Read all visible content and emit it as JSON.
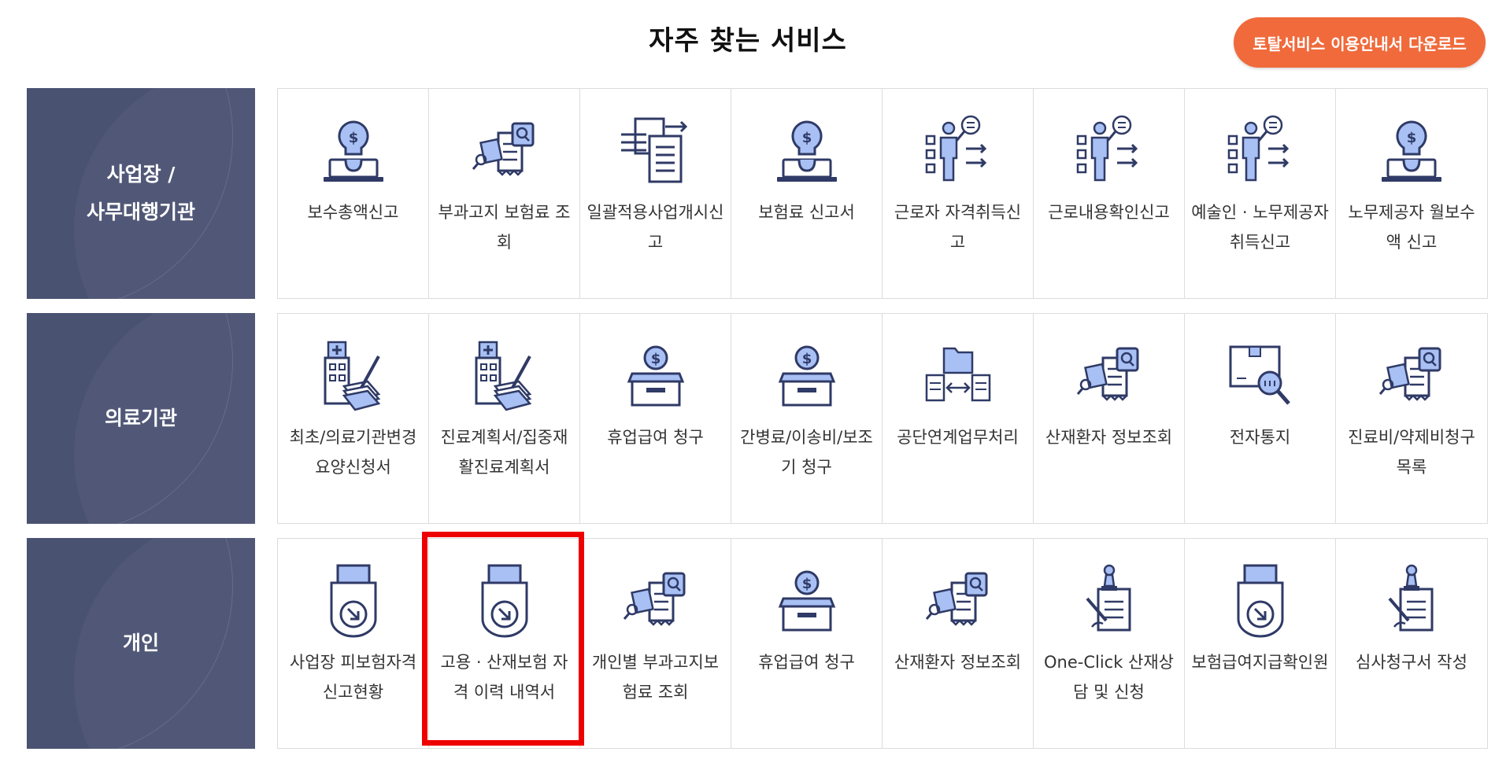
{
  "header": {
    "title": "자주 찾는 서비스",
    "download_button": "토탈서비스 이용안내서 다운로드"
  },
  "colors": {
    "accent": "#f06a3b",
    "sidebar": "#4a5272",
    "icon_stroke": "#2f3a66",
    "icon_fill": "#a8c0f4",
    "highlight": "#ee0000"
  },
  "rows": [
    {
      "category": "사업장 /\n사무대행기관",
      "items": [
        {
          "label": "보수총액신고",
          "icon": "money-bulb-laptop-icon"
        },
        {
          "label": "부과고지 보험료 조회",
          "icon": "document-search-icon"
        },
        {
          "label": "일괄적용사업개시신고",
          "icon": "document-transfer-icon"
        },
        {
          "label": "보험료 신고서",
          "icon": "money-bulb-laptop-icon"
        },
        {
          "label": "근로자 자격취득신고",
          "icon": "presenter-checklist-icon"
        },
        {
          "label": "근로내용확인신고",
          "icon": "presenter-checklist-icon"
        },
        {
          "label": "예술인 · 노무제공자 취득신고",
          "icon": "presenter-checklist-icon"
        },
        {
          "label": "노무제공자 월보수액 신고",
          "icon": "money-bulb-laptop-icon"
        }
      ]
    },
    {
      "category": "의료기관",
      "items": [
        {
          "label": "최초/의료기관변경 요양신청서",
          "icon": "hospital-write-icon"
        },
        {
          "label": "진료계획서/집중재활진료계획서",
          "icon": "hospital-write-icon"
        },
        {
          "label": "휴업급여 청구",
          "icon": "coin-box-icon"
        },
        {
          "label": "간병료/이송비/보조기 청구",
          "icon": "coin-box-icon"
        },
        {
          "label": "공단연계업무처리",
          "icon": "folder-exchange-icon"
        },
        {
          "label": "산재환자 정보조회",
          "icon": "document-search-icon"
        },
        {
          "label": "전자통지",
          "icon": "package-search-icon"
        },
        {
          "label": "진료비/약제비청구목록",
          "icon": "document-search-icon"
        }
      ]
    },
    {
      "category": "개인",
      "items": [
        {
          "label": "사업장 피보험자격 신고현황",
          "icon": "printer-download-icon"
        },
        {
          "label": "고용 · 산재보험 자격 이력 내역서",
          "icon": "printer-download-icon"
        },
        {
          "label": "개인별 부과고지보험료 조회",
          "icon": "document-search-icon"
        },
        {
          "label": "휴업급여 청구",
          "icon": "coin-box-icon"
        },
        {
          "label": "산재환자 정보조회",
          "icon": "document-search-icon"
        },
        {
          "label": "One-Click 산재상담 및 신청",
          "icon": "stamp-document-icon"
        },
        {
          "label": "보험급여지급확인원",
          "icon": "printer-download-icon"
        },
        {
          "label": "심사청구서 작성",
          "icon": "stamp-document-icon"
        }
      ]
    }
  ]
}
